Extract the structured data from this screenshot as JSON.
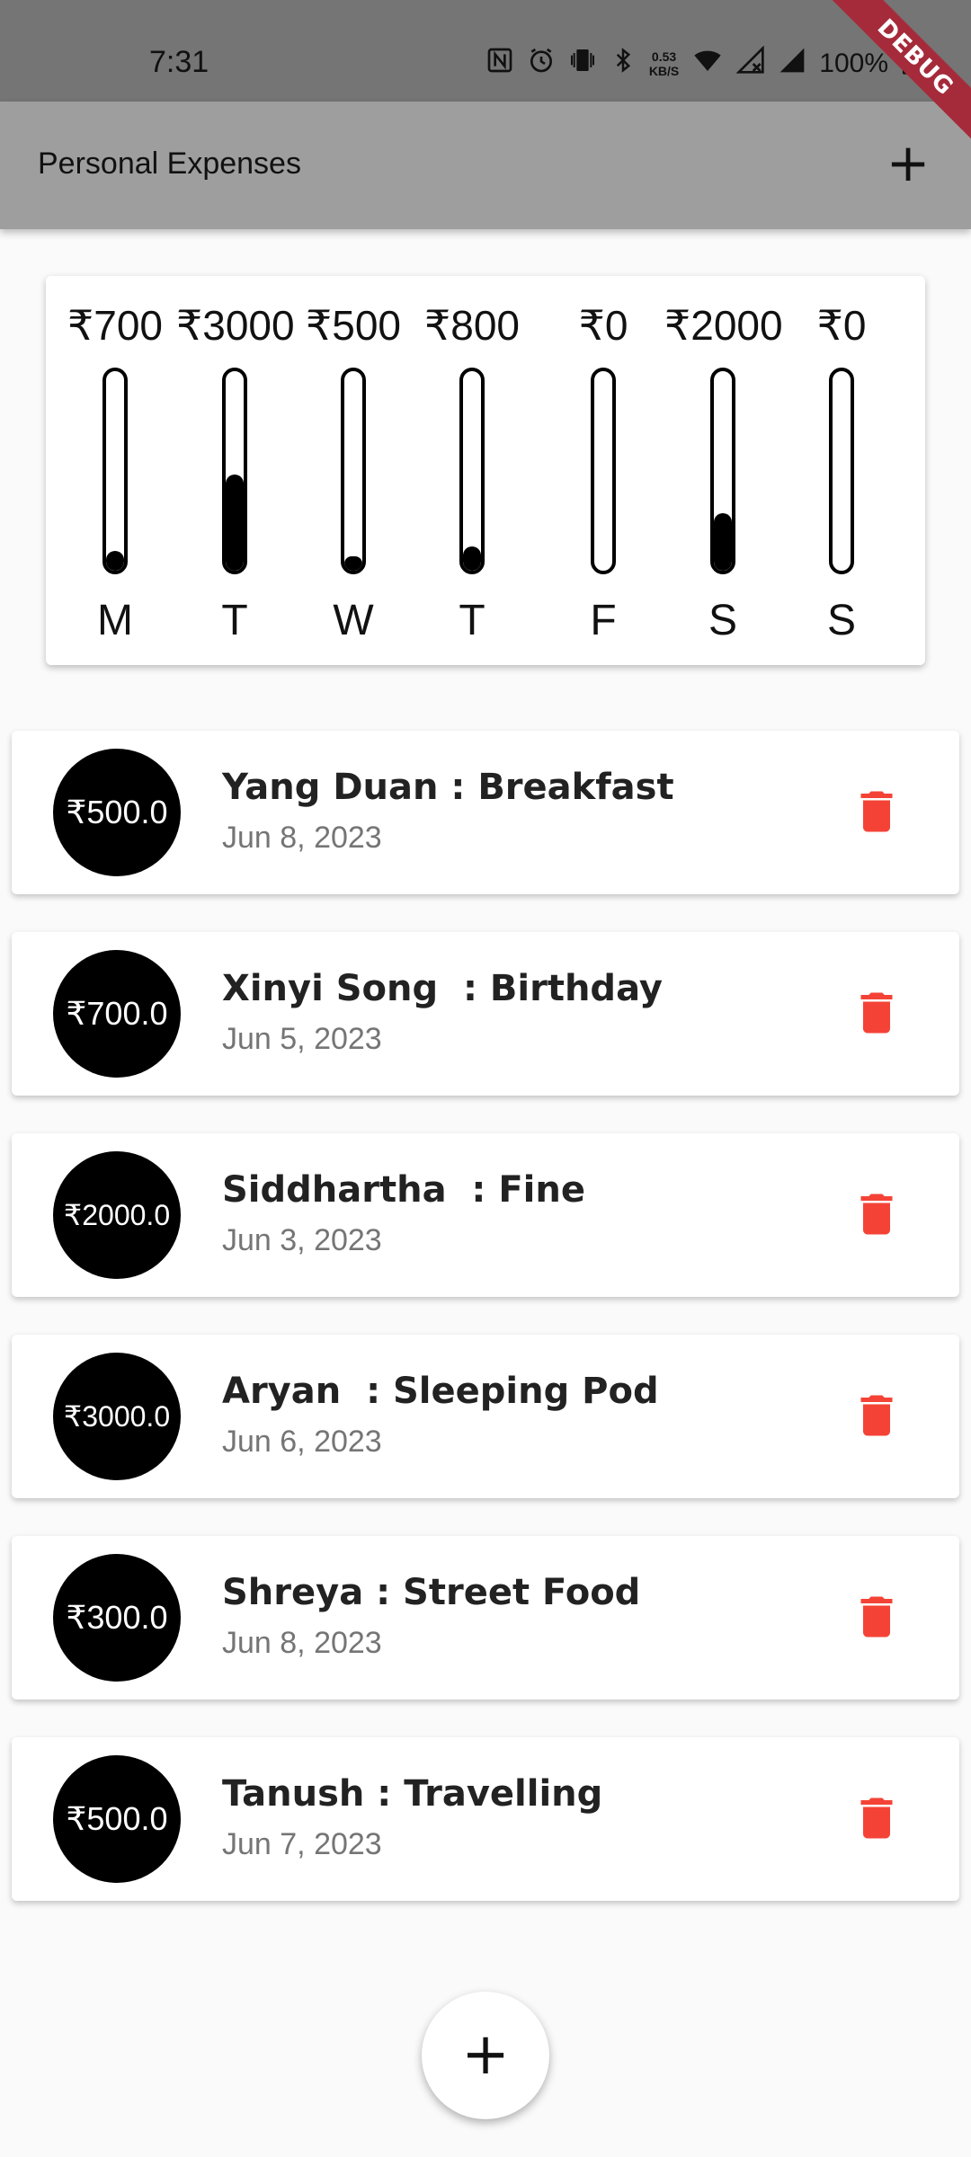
{
  "status_bar": {
    "time": "7:31",
    "net_speed_value": "0.53",
    "net_speed_unit": "KB/S",
    "battery": "100%",
    "icons": [
      "nfc-icon",
      "alarm-icon",
      "vibrate-icon",
      "bluetooth-icon",
      "wifi-icon",
      "signal-off-icon",
      "signal-icon",
      "battery-icon"
    ]
  },
  "debug_banner": "DEBUG",
  "app_bar": {
    "title": "Personal Expenses",
    "add_icon": "+"
  },
  "chart": {
    "days": [
      {
        "label": "M",
        "amount": "₹700",
        "fill": 0.1
      },
      {
        "label": "T",
        "amount": "₹3000",
        "fill": 0.48
      },
      {
        "label": "W",
        "amount": "₹500",
        "fill": 0.07
      },
      {
        "label": "T",
        "amount": "₹800",
        "fill": 0.12
      },
      {
        "label": "F",
        "amount": "₹0",
        "fill": 0.0
      },
      {
        "label": "S",
        "amount": "₹2000",
        "fill": 0.29
      },
      {
        "label": "S",
        "amount": "₹0",
        "fill": 0.0
      }
    ]
  },
  "transactions": [
    {
      "amount": "₹500.0",
      "title": "Yang Duan : Breakfast",
      "date": "Jun 8, 2023"
    },
    {
      "amount": "₹700.0",
      "title": "Xinyi Song  : Birthday",
      "date": "Jun 5, 2023"
    },
    {
      "amount": "₹2000.0",
      "title": "Siddhartha  : Fine",
      "date": "Jun 3, 2023"
    },
    {
      "amount": "₹3000.0",
      "title": "Aryan  : Sleeping Pod",
      "date": "Jun 6, 2023"
    },
    {
      "amount": "₹300.0",
      "title": "Shreya : Street Food",
      "date": "Jun 8, 2023"
    },
    {
      "amount": "₹500.0",
      "title": "Tanush : Travelling",
      "date": "Jun 7, 2023"
    }
  ],
  "colors": {
    "status_bar": "#757575",
    "app_bar": "#9e9e9e",
    "delete": "#f44336",
    "bar_fill": "#000000"
  },
  "fab": {
    "icon": "+"
  }
}
